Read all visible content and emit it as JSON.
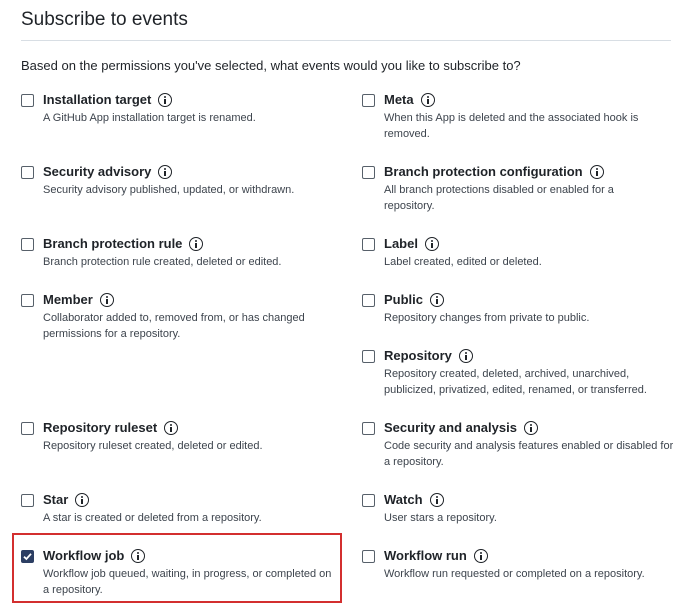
{
  "header": {
    "title": "Subscribe to events",
    "intro": "Based on the permissions you've selected, what events would you like to subscribe to?"
  },
  "events": [
    {
      "title": "Installation target",
      "desc": "A GitHub App installation target is renamed.",
      "checked": false
    },
    {
      "title": "Meta",
      "desc": "When this App is deleted and the associated hook is removed.",
      "checked": false
    },
    {
      "title": "Security advisory",
      "desc": "Security advisory published, updated, or withdrawn.",
      "checked": false
    },
    {
      "title": "Branch protection configuration",
      "desc": "All branch protections disabled or enabled for a repository.",
      "checked": false
    },
    {
      "title": "Branch protection rule",
      "desc": "Branch protection rule created, deleted or edited.",
      "checked": false
    },
    {
      "title": "Label",
      "desc": "Label created, edited or deleted.",
      "checked": false
    },
    {
      "title": "Member",
      "desc": "Collaborator added to, removed from, or has changed permissions for a repository.",
      "checked": false
    },
    {
      "title": "Public",
      "desc": "Repository changes from private to public.",
      "checked": false
    },
    {
      "title": "Repository",
      "desc": "Repository created, deleted, archived, unarchived, publicized, privatized, edited, renamed, or transferred.",
      "checked": false
    },
    {
      "title": "Repository ruleset",
      "desc": "Repository ruleset created, deleted or edited.",
      "checked": false
    },
    {
      "title": "Security and analysis",
      "desc": "Code security and analysis features enabled or disabled for a repository.",
      "checked": false
    },
    {
      "title": "Star",
      "desc": "A star is created or deleted from a repository.",
      "checked": false
    },
    {
      "title": "Watch",
      "desc": "User stars a repository.",
      "checked": false
    },
    {
      "title": "Workflow job",
      "desc": "Workflow job queued, waiting, in progress, or completed on a repository.",
      "checked": true
    },
    {
      "title": "Workflow run",
      "desc": "Workflow run requested or completed on a repository.",
      "checked": false
    }
  ],
  "colors": {
    "highlight": "#d32f2f",
    "checkbox_checked": "#2c3e63"
  }
}
